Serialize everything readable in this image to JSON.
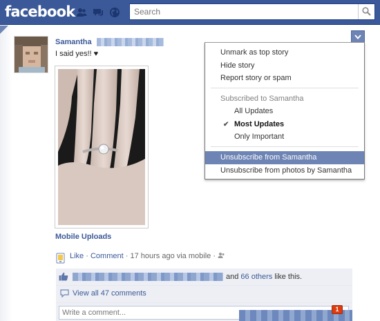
{
  "header": {
    "logo": "facebook",
    "search_placeholder": "Search"
  },
  "story": {
    "author": "Samantha",
    "message": "I said yes!! ♥",
    "album": "Mobile Uploads",
    "actions": {
      "like": "Like",
      "separator": "·",
      "comment": "Comment",
      "time": "17 hours ago via mobile"
    },
    "likes": {
      "text_and": "and",
      "others_link": "66 others",
      "text_suffix": "like this."
    },
    "view_comments": "View all 47 comments",
    "comment_placeholder": "Write a comment..."
  },
  "story_menu": {
    "items": [
      "Unmark as top story",
      "Hide story",
      "Report story or spam"
    ],
    "subscribed_header": "Subscribed to Samantha",
    "subscription_options": [
      "All Updates",
      "Most Updates",
      "Only Important"
    ],
    "selected_option": "Most Updates",
    "unsubscribe": "Unsubscribe from Samantha",
    "unsubscribe_photos": "Unsubscribe from photos by Samantha"
  },
  "notifications": {
    "count": "1"
  },
  "icons": {
    "friend_requests": "friends-icon",
    "messages": "messages-icon",
    "notifications": "globe-icon",
    "search": "magnifier-icon",
    "menu": "chevron-down-icon",
    "like": "thumbs-up-icon",
    "comments": "speech-bubble-icon",
    "audience": "friends-audience-icon",
    "mobile": "mobile-upload-icon"
  },
  "colors": {
    "brand": "#3b5998",
    "menu_highlight": "#6d84b4",
    "badge": "#dd3c10"
  }
}
